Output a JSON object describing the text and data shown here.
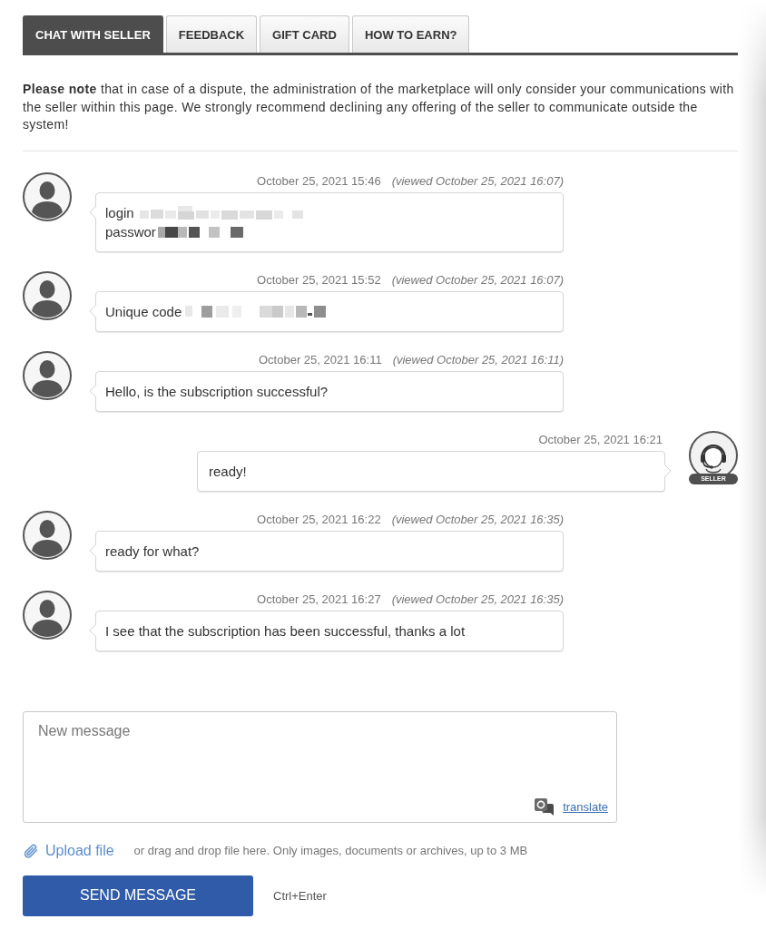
{
  "tabs": [
    {
      "label": "CHAT WITH SELLER",
      "selected": true
    },
    {
      "label": "FEEDBACK",
      "selected": false
    },
    {
      "label": "GIFT CARD",
      "selected": false
    },
    {
      "label": "HOW TO EARN?",
      "selected": false
    }
  ],
  "notice": "**Please note** that in case of a dispute, the administration of the marketplace will only consider your communications with the seller within this page. We strongly recommend declining any offering of the seller to communicate outside the system!",
  "messages": [
    {
      "kind": "buyer",
      "time": "October 25, 2021 15:46",
      "viewed": "(viewed October 25, 2021 16:07)",
      "lines": [
        {
          "text": "login",
          "redacted": true
        },
        {
          "text": "passwor",
          "redacted": true
        }
      ]
    },
    {
      "kind": "buyer",
      "time": "October 25, 2021 15:52",
      "viewed": "(viewed October 25, 2021 16:07)",
      "lines": [
        {
          "text": "Unique code",
          "redacted": true
        }
      ]
    },
    {
      "kind": "buyer",
      "time": "October 25, 2021 16:11",
      "viewed": "(viewed October 25, 2021 16:11)",
      "lines": [
        {
          "text": "Hello, is the subscription successful?",
          "redacted": false
        }
      ]
    },
    {
      "kind": "seller",
      "time": "October 25, 2021 16:21",
      "badge": "SELLER",
      "lines": [
        {
          "text": "ready!",
          "redacted": false
        }
      ]
    },
    {
      "kind": "buyer",
      "time": "October 25, 2021 16:22",
      "viewed": "(viewed October 25, 2021 16:35)",
      "lines": [
        {
          "text": "ready for what?",
          "redacted": false
        }
      ]
    },
    {
      "kind": "buyer",
      "time": "October 25, 2021 16:27",
      "viewed": "(viewed October 25, 2021 16:35)",
      "lines": [
        {
          "text": "I see that the subscription has been successful, thanks a lot",
          "redacted": false
        }
      ]
    }
  ],
  "composer": {
    "placeholder": "New message",
    "translate_link": "translate"
  },
  "upload": {
    "link": "Upload file",
    "hint": "or drag and drop file here. Only images, documents or archives, up to 3 MB"
  },
  "send": {
    "button": "SEND MESSAGE",
    "shortcut": "Ctrl+Enter"
  }
}
